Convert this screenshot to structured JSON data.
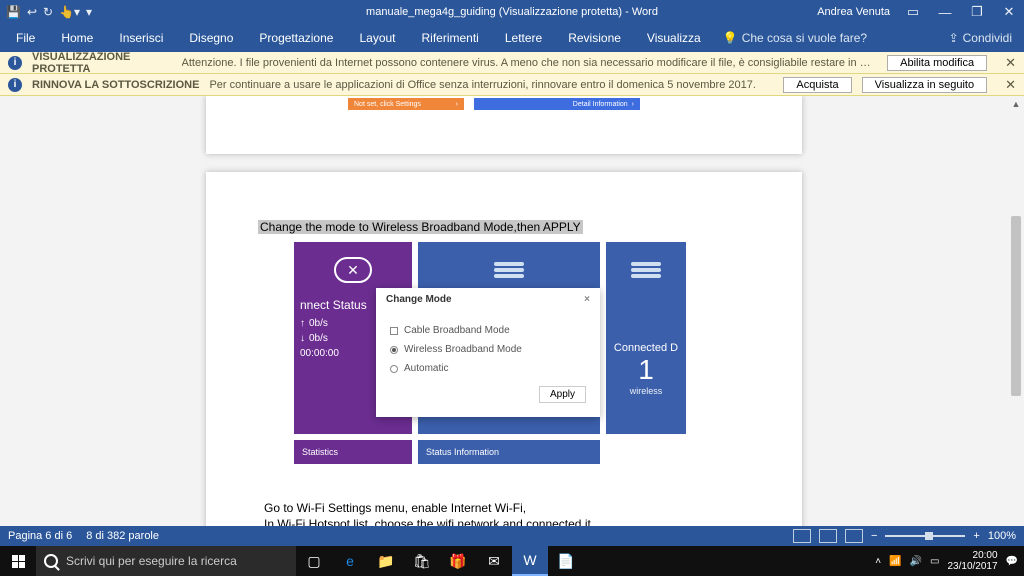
{
  "titlebar": {
    "title": "manuale_mega4g_guiding (Visualizzazione protetta) - Word",
    "user": "Andrea Venuta"
  },
  "ribbon": {
    "tabs": [
      "File",
      "Home",
      "Inserisci",
      "Disegno",
      "Progettazione",
      "Layout",
      "Riferimenti",
      "Lettere",
      "Revisione",
      "Visualizza"
    ],
    "tellme": "Che cosa si vuole fare?",
    "share": "Condividi"
  },
  "msg1": {
    "label": "VISUALIZZAZIONE PROTETTA",
    "text": "Attenzione. I file provenienti da Internet possono contenere virus. A meno che non sia necessario modificare il file, è consigliabile restare in Visualizzazione protetta.",
    "btn": "Abilita modifica"
  },
  "msg2": {
    "label": "RINNOVA LA SOTTOSCRIZIONE",
    "text": "Per continuare a usare le applicazioni di Office senza interruzioni, rinnovare entro il domenica 5 novembre 2017.",
    "btn1": "Acquista",
    "btn2": "Visualizza in seguito"
  },
  "doc": {
    "orange": "Not set, click Settings",
    "blue": "Detail Information",
    "instr1": "Change the mode to Wireless Broadband Mode,then APPLY",
    "purple_title": "nnect Status",
    "purple_up": "0b/s",
    "purple_down": "0b/s",
    "purple_time": "00:00:00",
    "blue2_title": "Connected D",
    "blue2_num": "1",
    "blue2_sub": "wireless",
    "bottom1": "Statistics",
    "bottom2": "Status Information",
    "modal_title": "Change Mode",
    "opt1": "Cable Broadband Mode",
    "opt2": "Wireless Broadband Mode",
    "opt3": "Automatic",
    "apply": "Apply",
    "instr2a": "Go to Wi-Fi Settings menu, enable Internet Wi-Fi,",
    "instr2b": "In Wi-Fi Hotspot list, choose the wifi network and connected it."
  },
  "status": {
    "page": "Pagina 6 di 6",
    "words": "8 di 382 parole",
    "zoom": "100%"
  },
  "taskbar": {
    "search": "Scrivi qui per eseguire la ricerca",
    "time": "20:00",
    "date": "23/10/2017"
  }
}
